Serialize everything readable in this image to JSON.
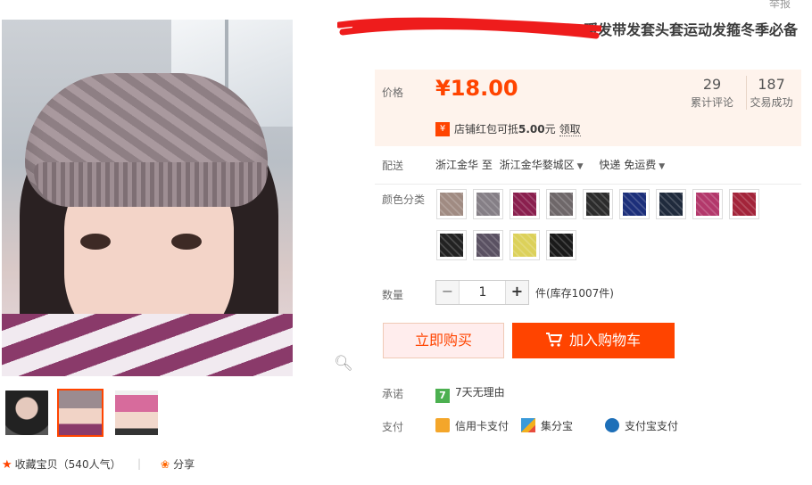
{
  "header": {
    "report_label": "举报",
    "title_visible": "暖发带发套头套运动发箍冬季必备"
  },
  "gallery": {
    "zoom_icon": "magnifier-icon",
    "thumbnails": [
      {
        "name": "thumb-1"
      },
      {
        "name": "thumb-2",
        "selected": true
      },
      {
        "name": "thumb-3"
      }
    ]
  },
  "actions": {
    "favorite_label": "收藏宝贝",
    "favorite_count": "（540人气）",
    "separator": "|",
    "share_label": "分享"
  },
  "price": {
    "label": "价格",
    "currency": "¥",
    "value": "18.00",
    "reviews_count": "29",
    "reviews_label": "累计评论",
    "sales_count": "187",
    "sales_label": "交易成功"
  },
  "coupon": {
    "icon": "¥",
    "text_pre": "店铺红包可抵",
    "amount": "5.00",
    "text_post": "元",
    "action": "领取"
  },
  "shipping": {
    "label": "配送",
    "from": "浙江金华 至",
    "to": "浙江金华婺城区",
    "method": "快递 免运费"
  },
  "color": {
    "label": "颜色分类",
    "swatches": [
      "#a08b82",
      "#857f86",
      "#8a1f4e",
      "#6e6769",
      "#2c2c2c",
      "#1c2f7a",
      "#1f2a3c",
      "#b3386b",
      "#a3243a",
      "#222222",
      "#5a5162",
      "#dcd15a",
      "#1a1a1a"
    ]
  },
  "quantity": {
    "label": "数量",
    "minus": "−",
    "value": "1",
    "plus": "+",
    "stock": "件(库存1007件)"
  },
  "buttons": {
    "buy": "立即购买",
    "cart": "加入购物车",
    "cart_icon": "cart-icon"
  },
  "promise": {
    "label": "承诺",
    "icon": "7",
    "text": "7天无理由"
  },
  "payment": {
    "label": "支付",
    "methods": [
      {
        "name": "信用卡支付",
        "color": "#f4a62a"
      },
      {
        "name": "集分宝",
        "color": "#3a9ad9"
      },
      {
        "name": "支付宝支付",
        "color": "#1d6fb8"
      }
    ]
  },
  "colors": {
    "accent": "#ff4400",
    "price_bg": "#fef3ec",
    "buy_bg": "#ffeded"
  }
}
